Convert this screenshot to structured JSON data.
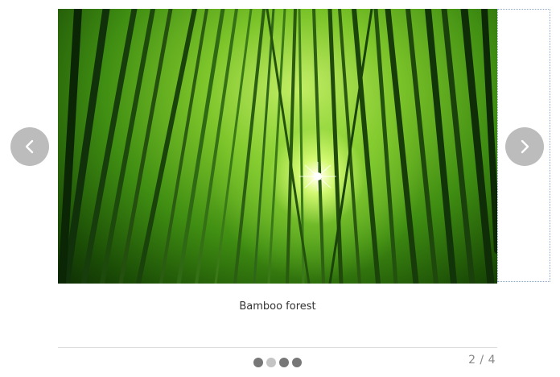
{
  "slider": {
    "image_alt": "Bamboo forest photo",
    "caption": "Bamboo forest",
    "counter": "2 / 4",
    "prev_icon": "chevron-left-icon",
    "next_icon": "chevron-right-icon",
    "dots": [
      {
        "active": false
      },
      {
        "active": true
      },
      {
        "active": false
      },
      {
        "active": false
      }
    ],
    "colors": {
      "nav_button": "#bcbcbc",
      "dot": "#777777",
      "dot_active": "#c4c4c4"
    }
  }
}
